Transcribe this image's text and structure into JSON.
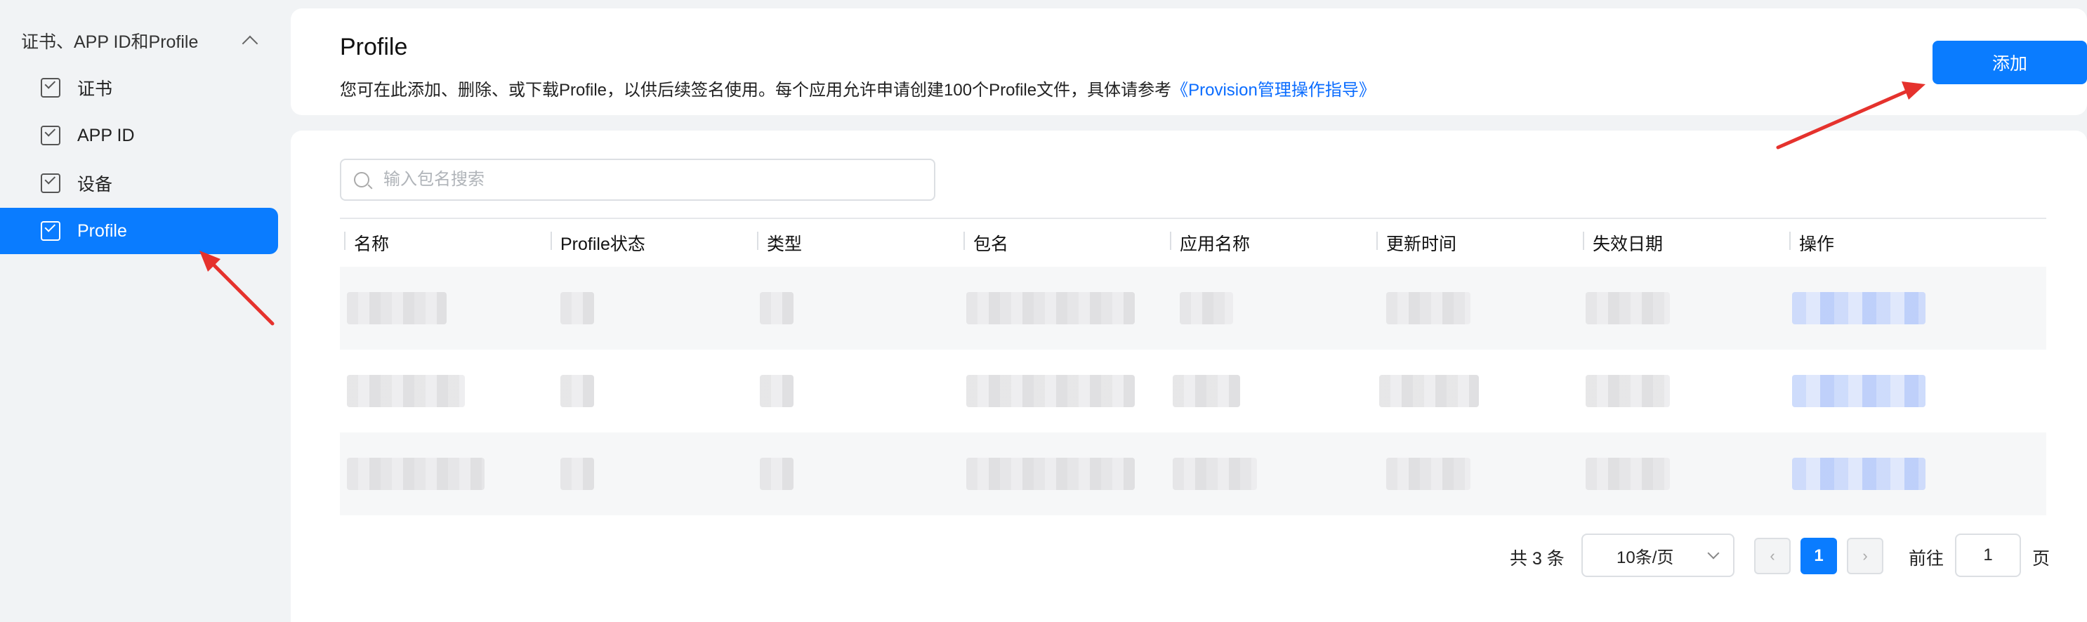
{
  "sidebar": {
    "group_label": "证书、APP ID和Profile",
    "items": [
      {
        "label": "证书",
        "active": false
      },
      {
        "label": "APP ID",
        "active": false
      },
      {
        "label": "设备",
        "active": false
      },
      {
        "label": "Profile",
        "active": true
      }
    ]
  },
  "header": {
    "title": "Profile",
    "description": "您可在此添加、删除、或下载Profile，以供后续签名使用。每个应用允许申请创建100个Profile文件，具体请参考",
    "guide_link": "《Provision管理操作指导》",
    "add_label": "添加"
  },
  "search": {
    "placeholder": "输入包名搜索"
  },
  "table": {
    "columns": [
      "名称",
      "Profile状态",
      "类型",
      "包名",
      "应用名称",
      "更新时间",
      "失效日期",
      "操作"
    ],
    "row_count_visible": 3
  },
  "pagination": {
    "total_text": "共 3 条",
    "page_size": "10条/页",
    "prev_icon": "‹",
    "next_icon": "›",
    "current_page": "1",
    "goto_label": "前往",
    "goto_value": "1",
    "page_suffix": "页"
  },
  "colors": {
    "accent": "#0a7cff",
    "annotation_arrow": "#e5322d"
  }
}
